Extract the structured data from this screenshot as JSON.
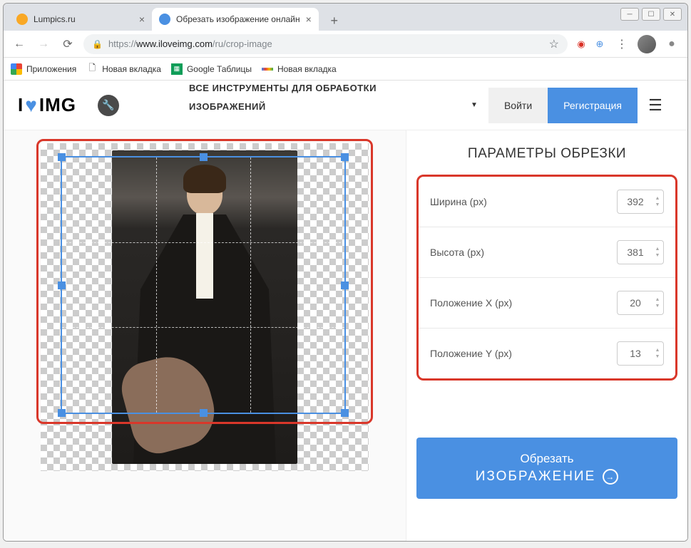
{
  "tabs": [
    {
      "title": "Lumpics.ru",
      "favicon_color": "#f9a825"
    },
    {
      "title": "Обрезать изображение онлайн",
      "favicon_color": "#4a90e2"
    }
  ],
  "nav": {
    "url_scheme": "https://",
    "url_host": "www.iloveimg.com",
    "url_path": "/ru/crop-image"
  },
  "bookmarks": {
    "apps": "Приложения",
    "new_tab1": "Новая вкладка",
    "sheets": "Google Таблицы",
    "new_tab2": "Новая вкладка"
  },
  "site": {
    "logo_left": "I",
    "logo_right": "IMG",
    "tools_text_line1": "ВСЕ ИНСТРУМЕНТЫ ДЛЯ ОБРАБОТКИ",
    "tools_text_line2": "ИЗОБРАЖЕНИЙ",
    "login": "Войти",
    "register": "Регистрация"
  },
  "crop": {
    "panel_title": "ПАРАМЕТРЫ ОБРЕЗКИ",
    "width_label": "Ширина (px)",
    "width_value": "392",
    "height_label": "Высота (px)",
    "height_value": "381",
    "posx_label": "Положение X (px)",
    "posx_value": "20",
    "posy_label": "Положение Y (px)",
    "posy_value": "13",
    "button_line1": "Обрезать",
    "button_line2": "ИЗОБРАЖЕНИЕ"
  }
}
